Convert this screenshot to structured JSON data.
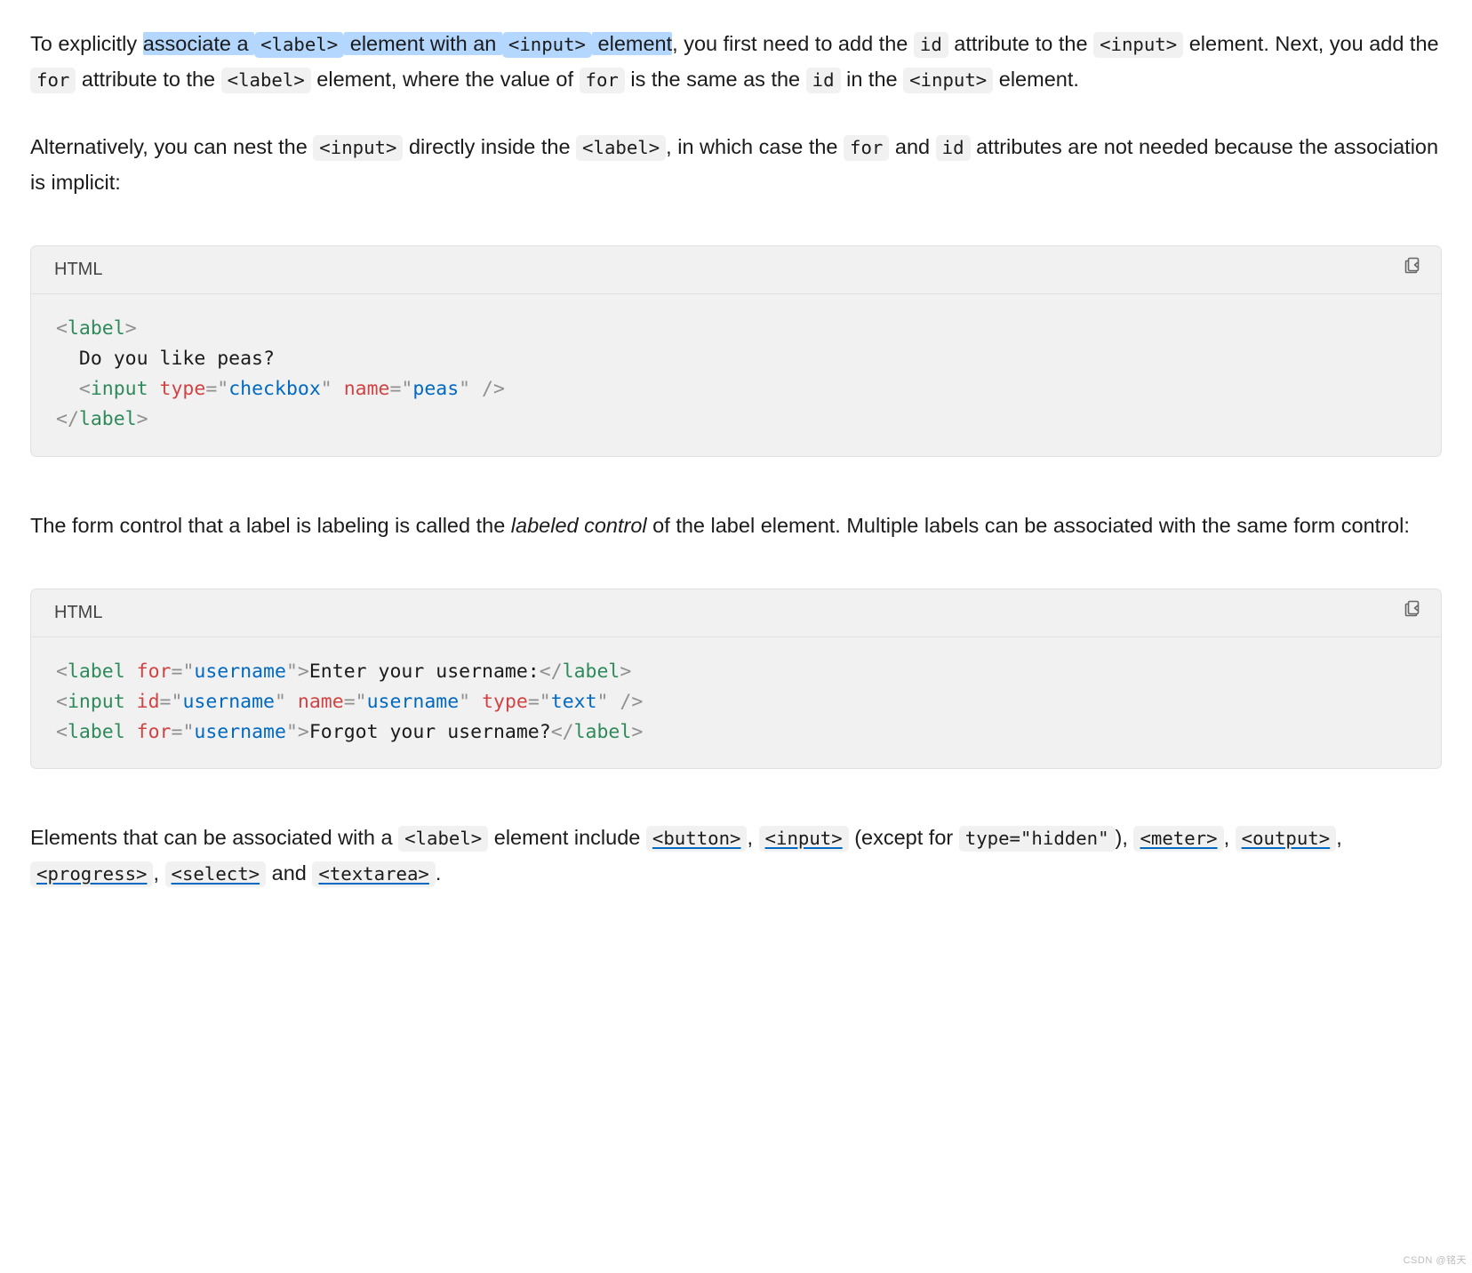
{
  "para1": {
    "t1": "To explicitly ",
    "h1": "associate a ",
    "c1": "<label>",
    "h2": " element with an ",
    "c2": "<input>",
    "h3": " element",
    "t2": ", you first need to add the ",
    "c3": "id",
    "t3": " attribute to the ",
    "c4": "<input>",
    "t4": " element. Next, you add the ",
    "c5": "for",
    "t5": " attribute to the ",
    "c6": "<label>",
    "t6": " element, where the value of ",
    "c7": "for",
    "t7": " is the same as the ",
    "c8": "id",
    "t8": " in the ",
    "c9": "<input>",
    "t9": " element."
  },
  "para2": {
    "t1": "Alternatively, you can nest the ",
    "c1": "<input>",
    "t2": " directly inside the ",
    "c2": "<label>",
    "t3": ", in which case the ",
    "c3": "for",
    "t4": " and ",
    "c4": "id",
    "t5": " attributes are not needed because the association is implicit:"
  },
  "codeblock_label": "HTML",
  "code1": {
    "l1_open": "<",
    "l1_tag": "label",
    "l1_close": ">",
    "l2_txt": "  Do you like peas?",
    "l3_indent": "  ",
    "l3_open": "<",
    "l3_tag": "input",
    "l3_sp1": " ",
    "l3_attr1": "type",
    "l3_eq1": "=",
    "l3_q1a": "\"",
    "l3_val1": "checkbox",
    "l3_q1b": "\"",
    "l3_sp2": " ",
    "l3_attr2": "name",
    "l3_eq2": "=",
    "l3_q2a": "\"",
    "l3_val2": "peas",
    "l3_q2b": "\"",
    "l3_close": " />",
    "l4_open": "</",
    "l4_tag": "label",
    "l4_close": ">"
  },
  "para3": {
    "t1": "The form control that a label is labeling is called the ",
    "em1": "labeled control",
    "t2": " of the label element. Multiple labels can be associated with the same form control:"
  },
  "code2": {
    "a_open": "<",
    "a_tag": "label",
    "a_sp": " ",
    "a_attr": "for",
    "a_eq": "=",
    "a_q1": "\"",
    "a_val": "username",
    "a_q2": "\"",
    "a_close1": ">",
    "a_txt": "Enter your username:",
    "a_endopen": "</",
    "a_endtag": "label",
    "a_endclose": ">",
    "b_open": "<",
    "b_tag": "input",
    "b_sp1": " ",
    "b_attr1": "id",
    "b_eq1": "=",
    "b_q1a": "\"",
    "b_val1": "username",
    "b_q1b": "\"",
    "b_sp2": " ",
    "b_attr2": "name",
    "b_eq2": "=",
    "b_q2a": "\"",
    "b_val2": "username",
    "b_q2b": "\"",
    "b_sp3": " ",
    "b_attr3": "type",
    "b_eq3": "=",
    "b_q3a": "\"",
    "b_val3": "text",
    "b_q3b": "\"",
    "b_close": " />",
    "c_open": "<",
    "c_tag": "label",
    "c_sp": " ",
    "c_attr": "for",
    "c_eq": "=",
    "c_q1": "\"",
    "c_val": "username",
    "c_q2": "\"",
    "c_close1": ">",
    "c_txt": "Forgot your username?",
    "c_endopen": "</",
    "c_endtag": "label",
    "c_endclose": ">"
  },
  "para4": {
    "t1": "Elements that can be associated with a ",
    "c1": "<label>",
    "t2": " element include ",
    "l1": "<button>",
    "t3": ", ",
    "l2": "<input>",
    "t4": " (except for ",
    "c2": "type=\"hidden\"",
    "t5": "), ",
    "l3": "<meter>",
    "t6": ", ",
    "l4": "<output>",
    "t7": ", ",
    "l5": "<progress>",
    "t8": ", ",
    "l6": "<select>",
    "t9": " and ",
    "l7": "<textarea>",
    "t10": "."
  },
  "watermark": "CSDN @铭天"
}
